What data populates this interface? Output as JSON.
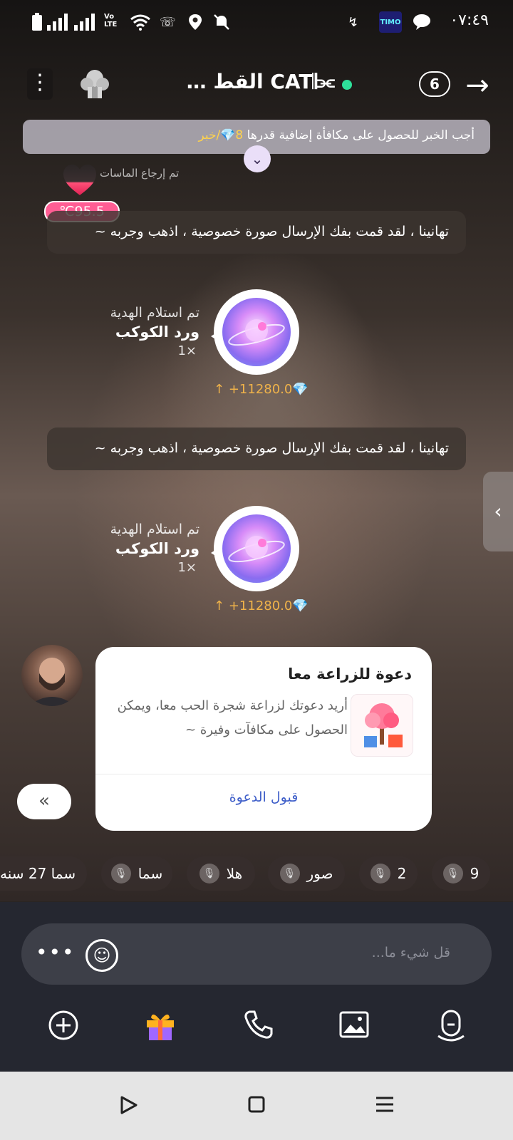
{
  "status_bar": {
    "time": "٠٧:٤٩",
    "volte_label": "Vo LTE",
    "app_badge": "TIMO"
  },
  "header": {
    "title": "… القط CAT𝄂⫘",
    "member_count": "6",
    "back_icon": "arrow-right-icon",
    "more_icon": "more-vertical-icon"
  },
  "notice": {
    "text_main": "أجب الخبر للحصول على مكافأة إضافية قدرها",
    "amount": "8",
    "link": "/خبر"
  },
  "diamonds_returned": "تم إرجاع الماسات",
  "temperature": "℃95.5",
  "messages": [
    {
      "text": "تهانينا ، لقد قمت بفك الإرسال صورة خصوصية ، اذهب وجربه ~"
    },
    {
      "text": "تهانينا ، لقد قمت بفك الإرسال صورة خصوصية ، اذهب وجربه ~"
    }
  ],
  "gifts": [
    {
      "label": "تم استلام الهدية",
      "name": "ورد الكوكب",
      "qty": "1×",
      "amount": "+11280.0"
    },
    {
      "label": "تم استلام الهدية",
      "name": "ورد الكوكب",
      "qty": "1×",
      "amount": "+11280.0"
    }
  ],
  "invite": {
    "title": "دعوة للزراعة معا",
    "body": "أريد دعوتك لزراعة شجرة الحب معا، ويمكن الحصول على مكافآت وفيرة ~",
    "accept": "قبول الدعوة"
  },
  "quick_replies": [
    "9",
    "2",
    "صور",
    "هلا",
    "سما",
    "سما 27 سنه"
  ],
  "composer": {
    "placeholder": "قل شيء ما...",
    "tools": [
      "voice-icon",
      "image-icon",
      "phone-icon",
      "gift-icon",
      "add-icon"
    ]
  },
  "colors": {
    "online": "#2ee09a",
    "temperature_pill": "#ff5d94",
    "accent_link": "#3f5fc9",
    "amount": "#f0b34a"
  }
}
